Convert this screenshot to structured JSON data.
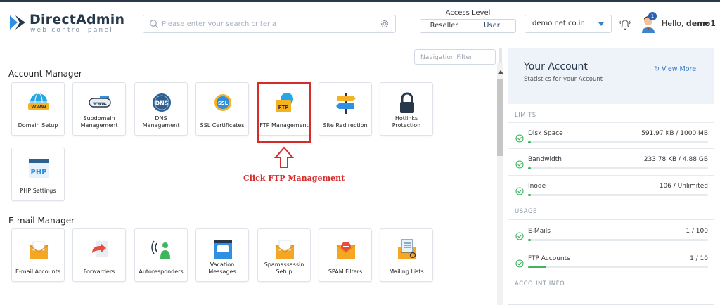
{
  "header": {
    "brand_title": "DirectAdmin",
    "brand_sub": "web control panel",
    "search_placeholder": "Please enter your search criteria",
    "access_level_title": "Access Level",
    "access_reseller": "Reseller",
    "access_user": "User",
    "domain": "demo.net.co.in",
    "notifications_count": "1",
    "hello_prefix": "Hello, ",
    "username": "demo1"
  },
  "nav_filter_placeholder": "Navigation Filter",
  "sections": {
    "account_manager": {
      "title": "Account Manager",
      "tiles": [
        {
          "label": "Domain Setup",
          "icon": "globe-www-icon"
        },
        {
          "label": "Subdomain Management",
          "icon": "subdomain-www-icon"
        },
        {
          "label": "DNS Management",
          "icon": "dns-icon"
        },
        {
          "label": "SSL Certificates",
          "icon": "ssl-badge-icon"
        },
        {
          "label": "FTP Management",
          "icon": "ftp-folder-icon"
        },
        {
          "label": "Site Redirection",
          "icon": "signpost-icon"
        },
        {
          "label": "Hotlinks Protection",
          "icon": "padlock-icon"
        },
        {
          "label": "PHP Settings",
          "icon": "php-window-icon"
        }
      ]
    },
    "email_manager": {
      "title": "E-mail Manager",
      "tiles": [
        {
          "label": "E-mail Accounts",
          "icon": "envelope-icon"
        },
        {
          "label": "Forwarders",
          "icon": "forward-arrow-icon"
        },
        {
          "label": "Autoresponders",
          "icon": "autoresponder-icon"
        },
        {
          "label": "Vacation Messages",
          "icon": "vacation-message-icon"
        },
        {
          "label": "Spamassassin Setup",
          "icon": "spam-envelope-icon"
        },
        {
          "label": "SPAM Filters",
          "icon": "spam-filter-icon"
        },
        {
          "label": "Mailing Lists",
          "icon": "mailing-list-icon"
        }
      ]
    }
  },
  "annotation": "Click FTP Management",
  "account_panel": {
    "title": "Your Account",
    "subtitle": "Statistics for your Account",
    "view_more": "View More",
    "limits_label": "LIMITS",
    "usage_label": "USAGE",
    "account_info_label": "ACCOUNT INFO",
    "limits": [
      {
        "name": "Disk Space",
        "value": "591.97 KB / 1000 MB",
        "fraction": 0.01
      },
      {
        "name": "Bandwidth",
        "value": "233.78 KB / 4.88 GB",
        "fraction": 0.01
      },
      {
        "name": "Inode",
        "value": "106 / Unlimited",
        "fraction": 0.01
      }
    ],
    "usage": [
      {
        "name": "E-Mails",
        "value": "1 / 100",
        "fraction": 0.01
      },
      {
        "name": "FTP Accounts",
        "value": "1 / 10",
        "fraction": 0.1
      }
    ]
  },
  "colors": {
    "accent_blue": "#2f73c4",
    "highlight_red": "#d62b2b",
    "progress_green": "#3cb55e"
  }
}
